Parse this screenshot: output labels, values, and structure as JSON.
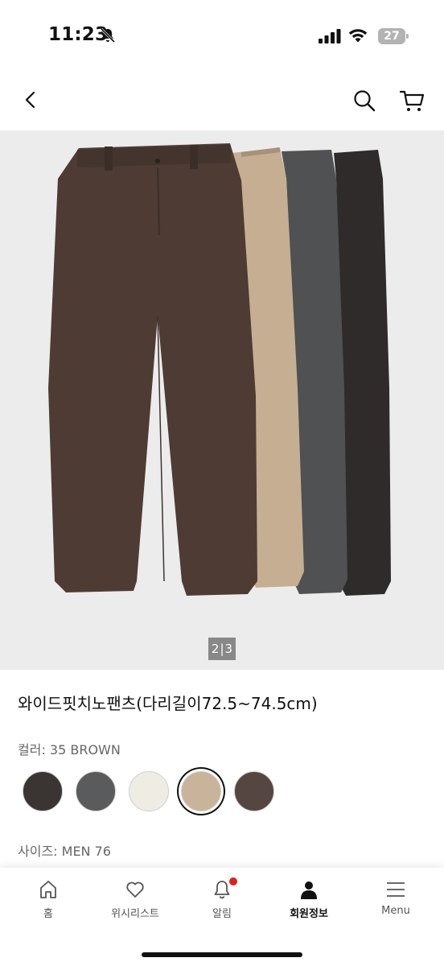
{
  "status_bar": {
    "time": "11:23",
    "battery": "27"
  },
  "image": {
    "pager_current": "2",
    "pager_total": "3"
  },
  "product": {
    "title": "와이드핏치노팬츠(다리길이72.5~74.5cm)"
  },
  "color": {
    "label": "컬러: 35 BROWN",
    "swatches": [
      {
        "name": "black",
        "hex": "#3a3533"
      },
      {
        "name": "gray",
        "hex": "#5a5b5c"
      },
      {
        "name": "off-white",
        "hex": "#efece4"
      },
      {
        "name": "beige",
        "hex": "#c9b39a",
        "selected": true
      },
      {
        "name": "brown",
        "hex": "#564641"
      }
    ]
  },
  "size": {
    "label": "사이즈: MEN 76"
  },
  "tab_bar": {
    "items": [
      {
        "label": "홈",
        "icon": "home-icon"
      },
      {
        "label": "위시리스트",
        "icon": "heart-icon"
      },
      {
        "label": "알림",
        "icon": "bell-icon",
        "badge": true
      },
      {
        "label": "회원정보",
        "icon": "person-icon",
        "active": true
      },
      {
        "label": "Menu",
        "icon": "menu-icon"
      }
    ]
  }
}
